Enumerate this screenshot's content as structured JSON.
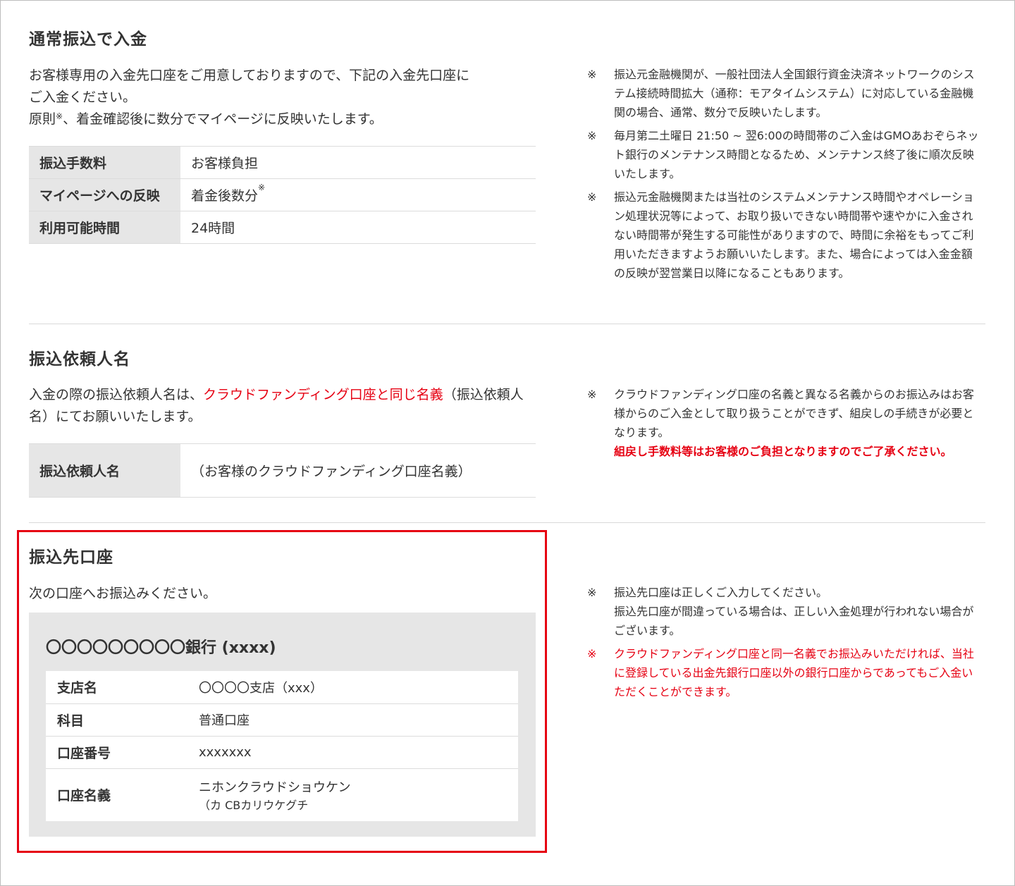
{
  "section1": {
    "heading": "通常振込で入金",
    "lead_line1": "お客様専用の入金先口座をご用意しておりますので、下記の入金先口座に",
    "lead_line2": "ご入金ください。",
    "lead_line3_pre": "原則",
    "lead_line3_sup": "※",
    "lead_line3_post": "、着金確認後に数分でマイページに反映いたします。",
    "table": [
      {
        "key": "振込手数料",
        "value": "お客様負担",
        "sup": ""
      },
      {
        "key": "マイページへの反映",
        "value": "着金後数分",
        "sup": "※"
      },
      {
        "key": "利用可能時間",
        "value": "24時間",
        "sup": ""
      }
    ],
    "notes": [
      {
        "mark": "※",
        "text": "振込元金融機関が、一般社団法人全国銀行資金決済ネットワークのシステム接続時間拡大（通称：モアタイムシステム）に対応している金融機関の場合、通常、数分で反映いたします。"
      },
      {
        "mark": "※",
        "text": "毎月第二土曜日 21:50 ~ 翌6:00の時間帯のご入金はGMOあおぞらネット銀行のメンテナンス時間となるため、メンテナンス終了後に順次反映いたします。"
      },
      {
        "mark": "※",
        "text": "振込元金融機関または当社のシステムメンテナンス時間やオペレーション処理状況等によって、お取り扱いできない時間帯や速やかに入金されない時間帯が発生する可能性がありますので、時間に余裕をもってご利用いただきますようお願いいたします。また、場合によっては入金金額の反映が翌営業日以降になることもあります。"
      }
    ]
  },
  "section2": {
    "heading": "振込依頼人名",
    "lead_pre": "入金の際の振込依頼人名は、",
    "lead_red": "クラウドファンディング口座と同じ名義",
    "lead_post": "（振込依頼人名）にてお願いいたします。",
    "table_key": "振込依頼人名",
    "table_value": "（お客様のクラウドファンディング口座名義）",
    "note_mark": "※",
    "note_text": "クラウドファンディング口座の名義と異なる名義からのお振込みはお客様からのご入金として取り扱うことができず、組戻しの手続きが必要となります。",
    "note_bold_red": "組戻し手数料等はお客様のご負担となりますのでご了承ください。"
  },
  "section3": {
    "heading": "振込先口座",
    "lead": "次の口座へお振込みください。",
    "bank_name": "〇〇〇〇〇〇〇〇〇銀行 (xxxx)",
    "rows": [
      {
        "key": "支店名",
        "value": "〇〇〇〇支店（xxx）"
      },
      {
        "key": "科目",
        "value": "普通口座"
      },
      {
        "key": "口座番号",
        "value": "xxxxxxx"
      },
      {
        "key": "口座名義",
        "value": "ニホンクラウドショウケン",
        "value2": "（カ CBカリウケグチ"
      }
    ],
    "notes": [
      {
        "mark": "※",
        "text": "振込先口座は正しくご入力してください。\n振込先口座が間違っている場合は、正しい入金処理が行われない場合がございます。",
        "red": false
      },
      {
        "mark": "※",
        "text": "クラウドファンディング口座と同一名義でお振込みいただければ、当社に登録している出金先銀行口座以外の銀行口座からであってもご入金いただくことができます。",
        "red": true
      }
    ]
  },
  "colors": {
    "accent_red": "#e60012",
    "key_bg": "#e6e6e6",
    "text": "#333333"
  }
}
